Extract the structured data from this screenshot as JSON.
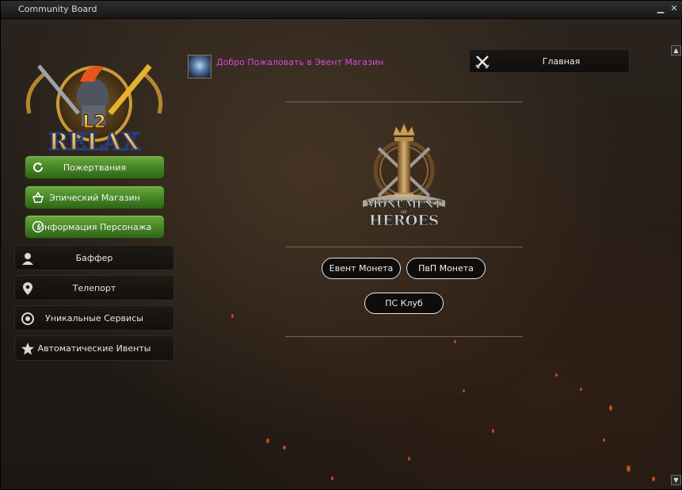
{
  "window": {
    "title": "Community Board"
  },
  "header": {
    "welcome": "Добро Пожаловать в Эвент Магазин"
  },
  "home": {
    "label": "Главная"
  },
  "logo": {
    "top_number": "L2",
    "text": "RELAX"
  },
  "sidebar": {
    "green_buttons": [
      {
        "label": "Пожертвания",
        "icon": "refresh-icon"
      },
      {
        "label": "Эпический Магазин",
        "icon": "basket-icon"
      },
      {
        "label": "Информация Персонажа",
        "icon": "info-icon"
      }
    ],
    "dark_buttons": [
      {
        "label": "Баффер",
        "icon": "user-icon"
      },
      {
        "label": "Телепорт",
        "icon": "map-pin-icon"
      },
      {
        "label": "Уникальные Сервисы",
        "icon": "gear-badge-icon"
      },
      {
        "label": "Автоматические Ивенты",
        "icon": "star-icon"
      }
    ]
  },
  "banner": {
    "line1": "MONUMENT",
    "line2": "OF",
    "line3": "HEROES"
  },
  "currency_buttons": [
    {
      "label": "Евент Монета"
    },
    {
      "label": "ПвП Монета"
    },
    {
      "label": "ПС Клуб"
    }
  ]
}
